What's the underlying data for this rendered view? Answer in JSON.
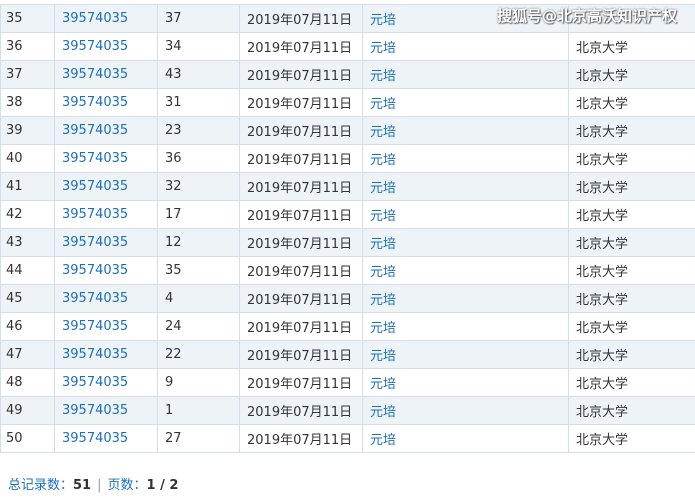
{
  "watermark": "搜狐号@北京高沃知识产权",
  "rows": [
    {
      "idx": "35",
      "code": "39574035",
      "count": "37",
      "date": "2019年07月11日",
      "person": "元培",
      "org": ""
    },
    {
      "idx": "36",
      "code": "39574035",
      "count": "34",
      "date": "2019年07月11日",
      "person": "元培",
      "org": "北京大学"
    },
    {
      "idx": "37",
      "code": "39574035",
      "count": "43",
      "date": "2019年07月11日",
      "person": "元培",
      "org": "北京大学"
    },
    {
      "idx": "38",
      "code": "39574035",
      "count": "31",
      "date": "2019年07月11日",
      "person": "元培",
      "org": "北京大学"
    },
    {
      "idx": "39",
      "code": "39574035",
      "count": "23",
      "date": "2019年07月11日",
      "person": "元培",
      "org": "北京大学"
    },
    {
      "idx": "40",
      "code": "39574035",
      "count": "36",
      "date": "2019年07月11日",
      "person": "元培",
      "org": "北京大学"
    },
    {
      "idx": "41",
      "code": "39574035",
      "count": "32",
      "date": "2019年07月11日",
      "person": "元培",
      "org": "北京大学"
    },
    {
      "idx": "42",
      "code": "39574035",
      "count": "17",
      "date": "2019年07月11日",
      "person": "元培",
      "org": "北京大学"
    },
    {
      "idx": "43",
      "code": "39574035",
      "count": "12",
      "date": "2019年07月11日",
      "person": "元培",
      "org": "北京大学"
    },
    {
      "idx": "44",
      "code": "39574035",
      "count": "35",
      "date": "2019年07月11日",
      "person": "元培",
      "org": "北京大学"
    },
    {
      "idx": "45",
      "code": "39574035",
      "count": "4",
      "date": "2019年07月11日",
      "person": "元培",
      "org": "北京大学"
    },
    {
      "idx": "46",
      "code": "39574035",
      "count": "24",
      "date": "2019年07月11日",
      "person": "元培",
      "org": "北京大学"
    },
    {
      "idx": "47",
      "code": "39574035",
      "count": "22",
      "date": "2019年07月11日",
      "person": "元培",
      "org": "北京大学"
    },
    {
      "idx": "48",
      "code": "39574035",
      "count": "9",
      "date": "2019年07月11日",
      "person": "元培",
      "org": "北京大学"
    },
    {
      "idx": "49",
      "code": "39574035",
      "count": "1",
      "date": "2019年07月11日",
      "person": "元培",
      "org": "北京大学"
    },
    {
      "idx": "50",
      "code": "39574035",
      "count": "27",
      "date": "2019年07月11日",
      "person": "元培",
      "org": "北京大学"
    }
  ],
  "footer": {
    "total_label": "总记录数：",
    "total_value": "51",
    "separator": "|",
    "pages_label": "页数：",
    "pages_value": "1 / 2"
  },
  "colors": {
    "link": "#1a6fc0",
    "row_alt": "#eef3f8",
    "border": "#d4dde8"
  }
}
